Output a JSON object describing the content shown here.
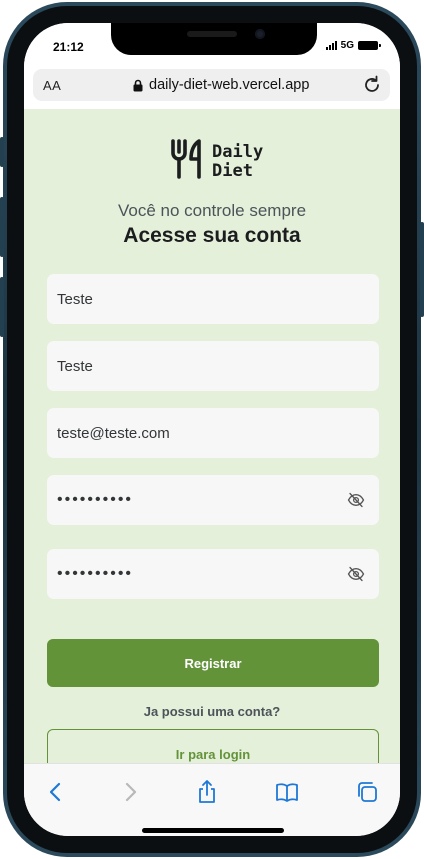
{
  "status_bar": {
    "time": "21:12",
    "network": "5G"
  },
  "browser": {
    "text_size_label": "AA",
    "url": "daily-diet-web.vercel.app",
    "accent_color": "#1e78d6"
  },
  "brand": {
    "logo_line1": "Daily",
    "logo_line2": "Diet"
  },
  "page": {
    "subtitle": "Você no controle sempre",
    "title": "Acesse sua conta"
  },
  "form": {
    "name_value": "Teste",
    "last_name_value": "Teste",
    "email_value": "teste@teste.com",
    "password_value": "••••••••••",
    "confirm_password_value": "••••••••••",
    "submit_label": "Registrar",
    "has_account_text": "Ja possui uma conta?",
    "login_label": "Ir para login"
  },
  "colors": {
    "background": "#e5f0db",
    "primary": "#639339",
    "input_background": "#f7f7f7",
    "text_dark": "#1b1d1e"
  },
  "toolbar_icons": [
    "back-icon",
    "forward-icon",
    "share-icon",
    "bookmarks-icon",
    "tabs-icon"
  ]
}
